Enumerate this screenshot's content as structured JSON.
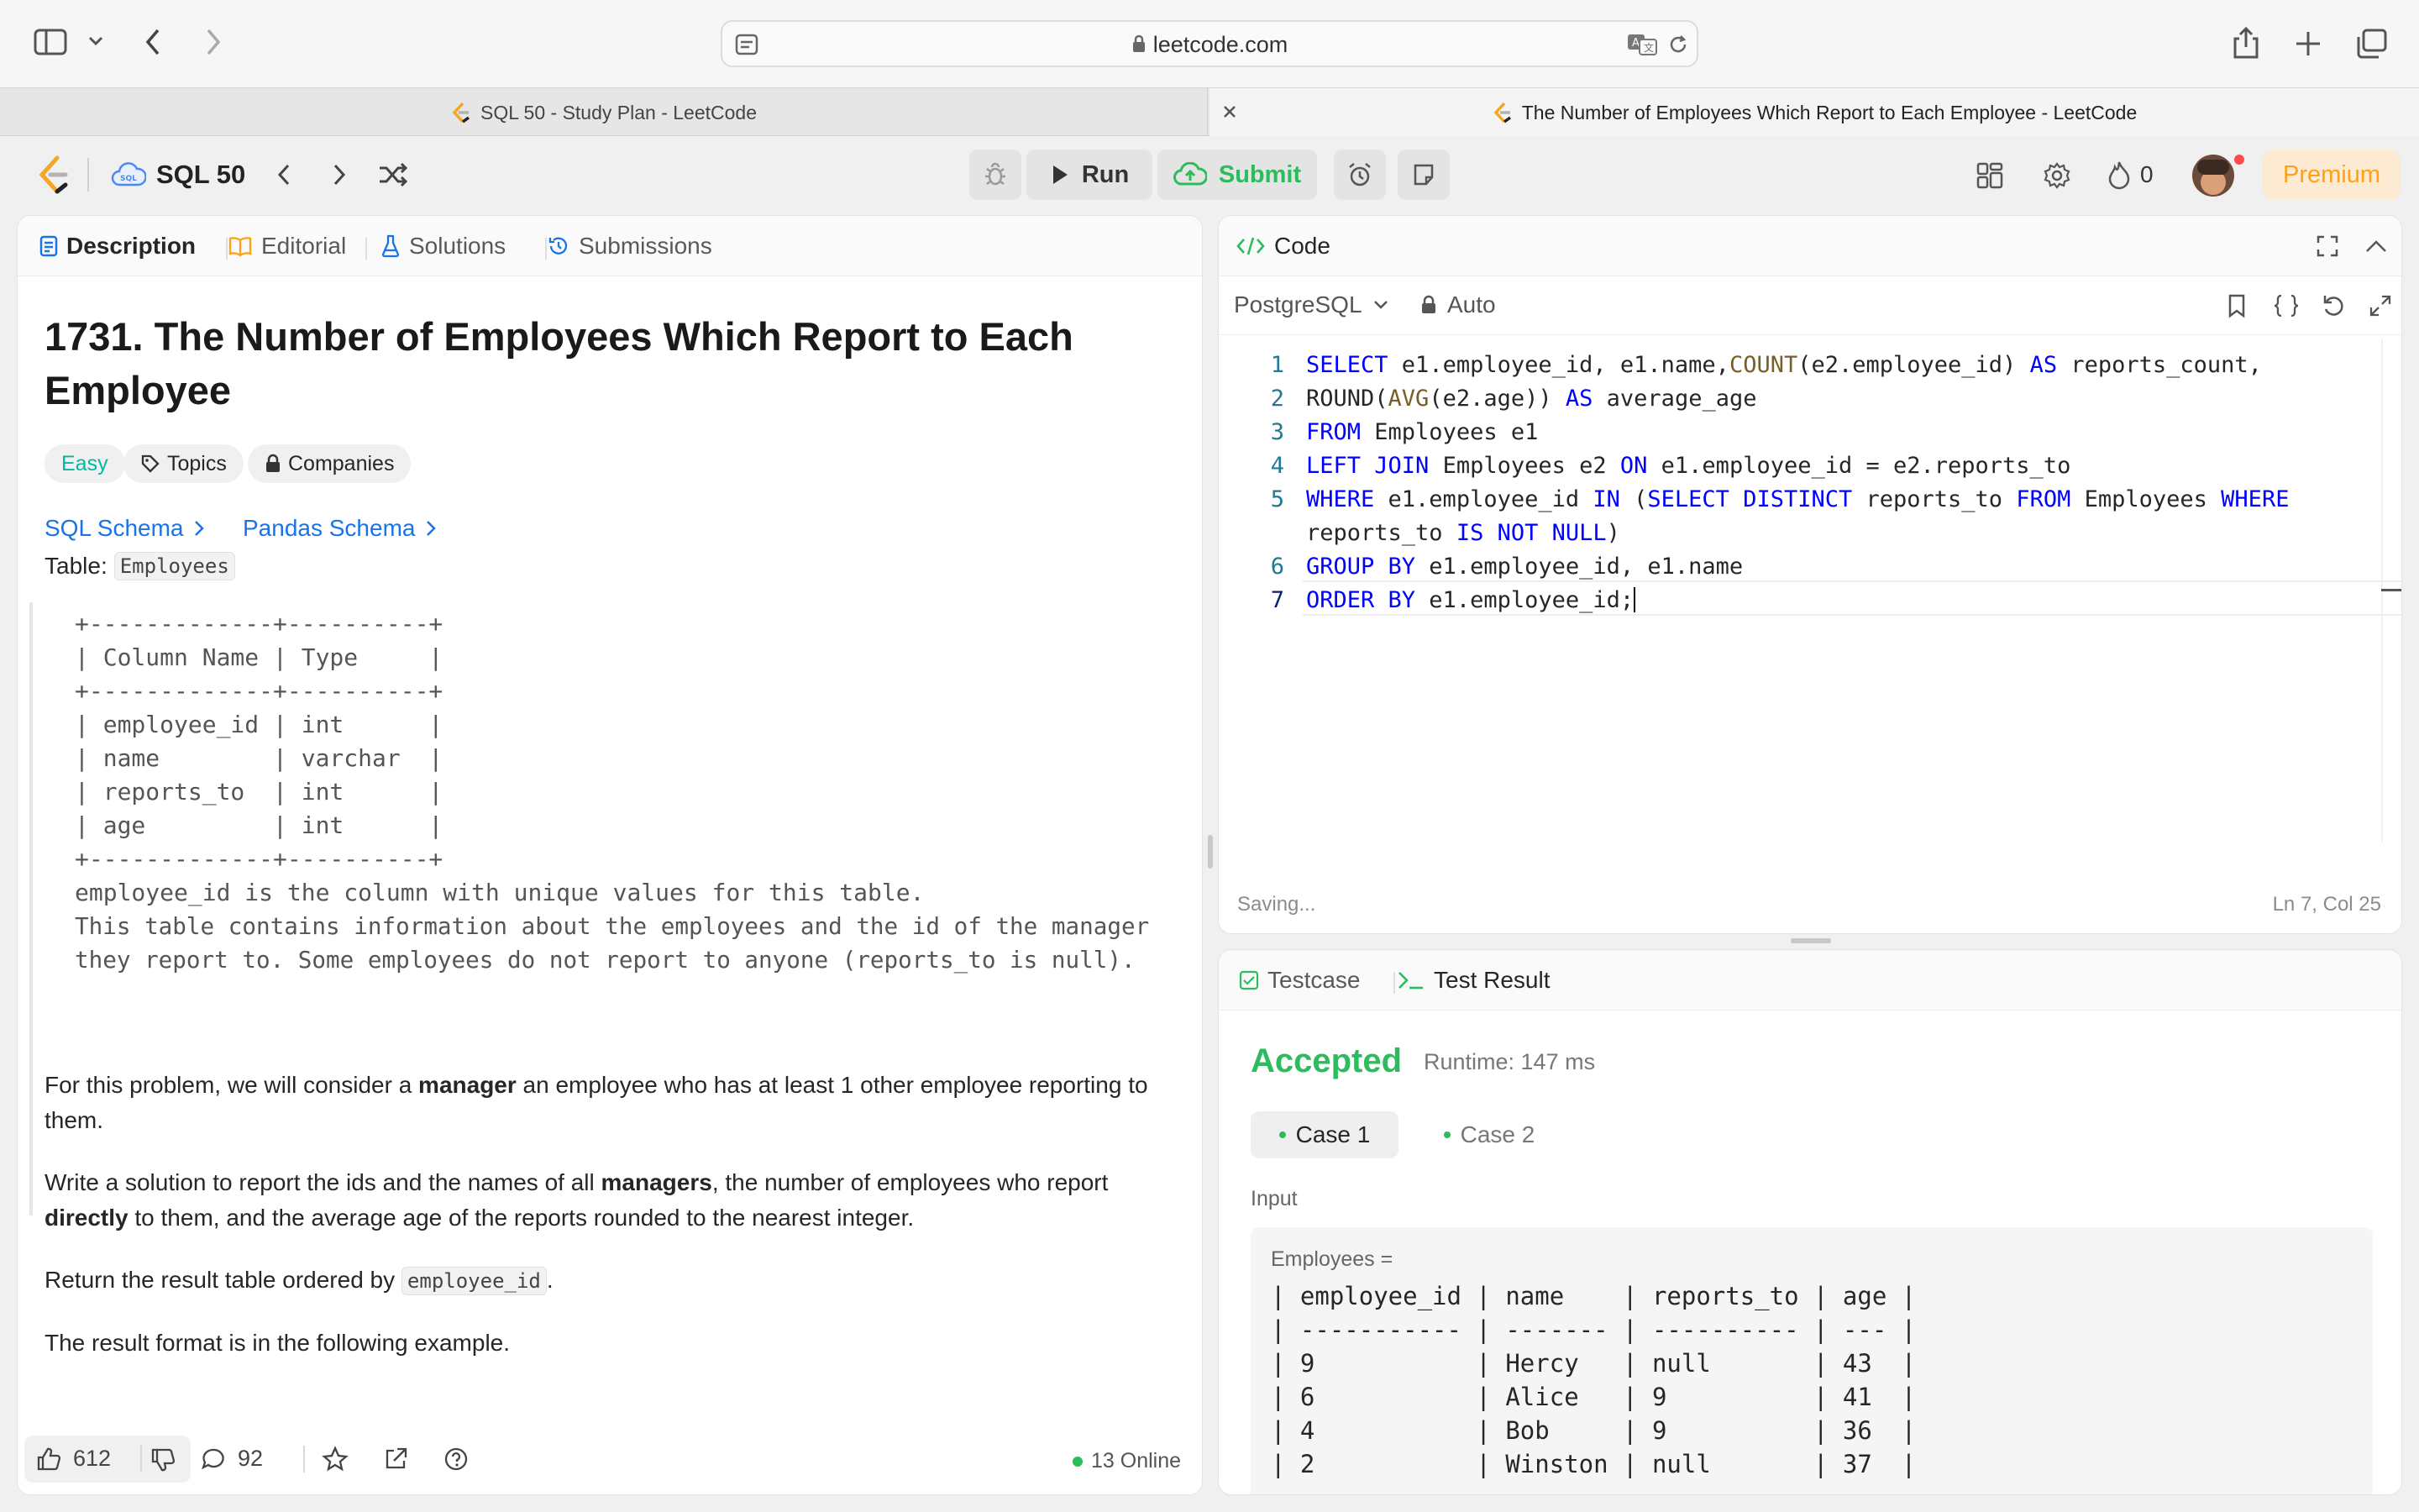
{
  "browser": {
    "url": "leetcode.com",
    "tabs": [
      "SQL 50 - Study Plan - LeetCode",
      "The Number of Employees Which Report to Each Employee - LeetCode"
    ]
  },
  "header": {
    "study_plan": "SQL 50",
    "run": "Run",
    "submit": "Submit",
    "streak": "0",
    "premium": "Premium"
  },
  "left_tabs": [
    "Description",
    "Editorial",
    "Solutions",
    "Submissions"
  ],
  "problem": {
    "title_line1": "1731. The Number of Employees Which Report to Each",
    "title_line2": "Employee",
    "difficulty": "Easy",
    "topics": "Topics",
    "companies": "Companies",
    "sql_schema": "SQL Schema",
    "pandas_schema": "Pandas Schema",
    "table_label": "Table:",
    "table_name": "Employees",
    "schema_lines": [
      "+-------------+----------+",
      "| Column Name | Type     |",
      "+-------------+----------+",
      "| employee_id | int      |",
      "| name        | varchar  |",
      "| reports_to  | int      |",
      "| age         | int      |",
      "+-------------+----------+",
      "employee_id is the column with unique values for this table.",
      "This table contains information about the employees and the id of the manager",
      "they report to. Some employees do not report to anyone (reports_to is null)."
    ],
    "p1_a": "For this problem, we will consider a ",
    "p1_b": "manager",
    "p1_c": " an employee who has at least 1 other employee reporting to them.",
    "p2_a": "Write a solution to report the ids and the names of all ",
    "p2_b": "managers",
    "p2_c": ", the number of employees who report ",
    "p2_d": "directly",
    "p2_e": " to them, and the average age of the reports rounded to the nearest integer.",
    "p3_a": "Return the result table ordered by ",
    "p3_code": "employee_id",
    "p3_c": ".",
    "p4": "The result format is in the following example."
  },
  "footer": {
    "likes": "612",
    "comments": "92",
    "online": "13 Online"
  },
  "code_panel": {
    "title": "Code",
    "language": "PostgreSQL",
    "mode": "Auto",
    "status": "Saving...",
    "cursor": "Ln 7, Col 25",
    "line_numbers": [
      "1",
      "2",
      "3",
      "4",
      "5",
      "",
      "6",
      "7"
    ]
  },
  "result_panel": {
    "tab_testcase": "Testcase",
    "tab_result": "Test Result",
    "status": "Accepted",
    "runtime": "Runtime: 147 ms",
    "case1": "Case 1",
    "case2": "Case 2",
    "input_label": "Input",
    "var_label": "Employees =",
    "table_lines": [
      "| employee_id | name    | reports_to | age |",
      "| ----------- | ------- | ---------- | --- |",
      "| 9           | Hercy   | null       | 43  |",
      "| 6           | Alice   | 9          | 41  |",
      "| 4           | Bob     | 9          | 36  |",
      "| 2           | Winston | null       | 37  |"
    ]
  },
  "colors": {
    "accent_green": "#2cbb5d",
    "easy": "#00b8a3",
    "link_blue": "#1a73e8",
    "premium": "#ffa116"
  }
}
